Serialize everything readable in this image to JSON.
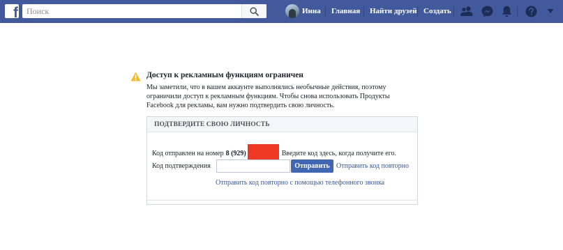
{
  "topbar": {
    "logo_letter": "f",
    "search": {
      "placeholder": "Поиск",
      "value": ""
    },
    "profile_name": "Инна",
    "nav": {
      "home": "Главная",
      "find_friends": "Найти друзей",
      "create": "Создать"
    },
    "icons": [
      "search-icon",
      "friend-requests-icon",
      "messenger-icon",
      "notifications-icon",
      "help-icon"
    ],
    "background_color": "#42599b"
  },
  "notice": {
    "title": "Доступ к рекламным функциям ограничен",
    "body": "Мы заметили, что в вашем аккаунте выполнялись необычные действия, поэтому ограничили доступ к рекламным функциям. Чтобы снова использовать Продукты Facebook для рекламы, вам нужно подтвердить свою личность.",
    "icon": "warning-icon",
    "icon_color": "#f7b928"
  },
  "verify": {
    "header": "ПОДТВЕРДИТЕ СВОЮ ЛИЧНОСТЬ",
    "code_sent_prefix": "Код отправлен на номер",
    "phone_partial": "8 (929)",
    "code_sent_suffix": "Введите код здесь, когда получите его.",
    "redaction_color": "#ed3926",
    "code_label": "Код подтверждения",
    "code_value": "",
    "submit_label": "Отправить",
    "resend_label": "Отправить код повторно",
    "call_label": "Отправить код повторно с помощью телефонного звонка",
    "button_color": "#4267b2",
    "link_color": "#385898"
  }
}
